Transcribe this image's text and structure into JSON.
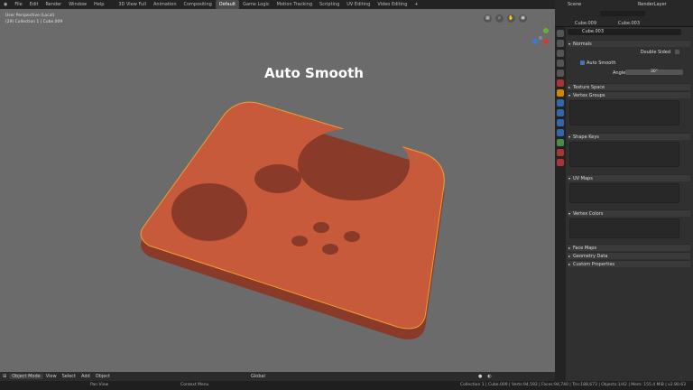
{
  "menu": [
    "File",
    "Edit",
    "Render",
    "Window",
    "Help"
  ],
  "workspaces": [
    "3D View Full",
    "Animation",
    "Compositing",
    "Default",
    "Game Logic",
    "Motion Tracking",
    "Scripting",
    "UV Editing",
    "Video Editing",
    "+"
  ],
  "active_workspace": "Default",
  "scene": "Scene",
  "view_layer": "RenderLayer",
  "viewport": {
    "view_name": "User Perspective (Local)",
    "collection": "(29) Collection 1 | Cube.009",
    "overlay_title": "Auto Smooth"
  },
  "viewport_header": {
    "mode": "Object Mode",
    "menus": [
      "View",
      "Select",
      "Add",
      "Object"
    ],
    "orientation": "Global"
  },
  "status": {
    "left": "Pan View",
    "middle": "Context Menu",
    "right": "Collection 1 | Cube.009 | Verts:94,592 | Faces:94,740 | Tris:188,673 | Objects:1/42 | Mem: 155.4 MiB | v2.80.63"
  },
  "properties": {
    "object": "Cube.009",
    "mesh": "Cube.003",
    "datablock": "Cube.003",
    "normals": {
      "label": "Normals",
      "double_sided": "Double Sided",
      "auto_smooth": "Auto Smooth",
      "auto_smooth_checked": true,
      "angle_label": "Angle",
      "angle": "30°"
    },
    "panels": [
      "Texture Space",
      "Vertex Groups",
      "Shape Keys",
      "UV Maps",
      "Vertex Colors",
      "Face Maps",
      "Geometry Data",
      "Custom Properties"
    ]
  },
  "colors": {
    "object": "#c85a3c",
    "selection": "#f0a030",
    "viewport_bg": "#6b6b6b"
  }
}
